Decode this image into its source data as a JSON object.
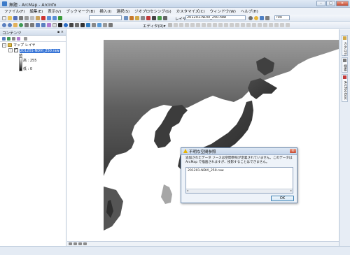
{
  "window": {
    "title": "無題 - ArcMap - ArcInfo"
  },
  "menu": [
    "ファイル(F)",
    "編集(E)",
    "表示(V)",
    "ブックマーク(B)",
    "挿入(I)",
    "選択(S)",
    "ジオプロセシング(G)",
    "カスタマイズ(C)",
    "ウィンドウ(W)",
    "ヘルプ(H)"
  ],
  "toolbar": {
    "scale_value": "",
    "layer_label": "レイヤ:",
    "layer_value": "201201-NDVI_250.raw",
    "zoom_value": "?00",
    "editor_label": "エディタ(R)▾"
  },
  "toc": {
    "title": "コンテンツ",
    "pin": "▪ ×",
    "group_label": "マップ レイヤ",
    "layer_name": "201201-NDVI_250.raw",
    "legend_title": "値",
    "legend_high": "高 : 255",
    "legend_low": "低 : 0"
  },
  "right_dock": [
    "カタログ",
    "検索",
    "ArcToolbox"
  ],
  "dialog": {
    "title": "不明な空間参照",
    "message": "追加されたデータ ソースは空間参照が定義されていません。このデータは ArcMap で描画されますが、投影することはできません。",
    "list_item": "201201-NDVI_250.raw",
    "ok_label": "OK"
  },
  "colors": {
    "accent": "#3875d7",
    "warning": "#e8b400",
    "map_land_dark": "#3a3a3a",
    "map_land_light": "#bdbdbd"
  }
}
